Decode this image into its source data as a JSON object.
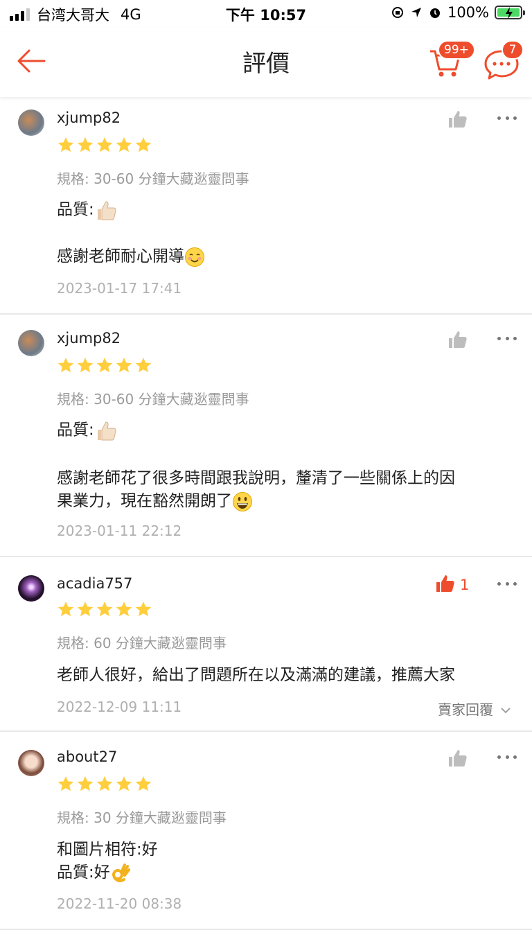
{
  "status_bar": {
    "carrier": "台湾大哥大",
    "network": "4G",
    "time": "下午 10:57",
    "battery": "100%"
  },
  "header": {
    "title": "評價",
    "cart_badge": "99+",
    "chat_badge": "7"
  },
  "colors": {
    "accent": "#ee4d2d",
    "star": "#ffce3d"
  },
  "reviews": [
    {
      "username": "xjump82",
      "rating": 5,
      "variation": "規格: 30-60 分鐘大藏逖靈問事",
      "quality_label": "品質:",
      "text": "感謝老師耐心開導",
      "time": "2023-01-17 17:41"
    },
    {
      "username": "xjump82",
      "rating": 5,
      "variation": "規格: 30-60 分鐘大藏逖靈問事",
      "quality_label": "品質:",
      "text_line1": "感謝老師花了很多時間跟我說明，釐清了一些關係上的因",
      "text_line2": "果業力，現在豁然開朗了",
      "time": "2023-01-11 22:12"
    },
    {
      "username": "acadia757",
      "rating": 5,
      "variation": "規格: 60 分鐘大藏逖靈問事",
      "text": "老師人很好，給出了問題所在以及滿滿的建議，推薦大家",
      "time": "2022-12-09 11:11",
      "like_count": "1",
      "seller_reply": "賣家回覆"
    },
    {
      "username": "about27",
      "rating": 5,
      "variation": "規格: 30 分鐘大藏逖靈問事",
      "line1": "和圖片相符:好",
      "line2": "品質:好",
      "time": "2022-11-20 08:38"
    }
  ]
}
